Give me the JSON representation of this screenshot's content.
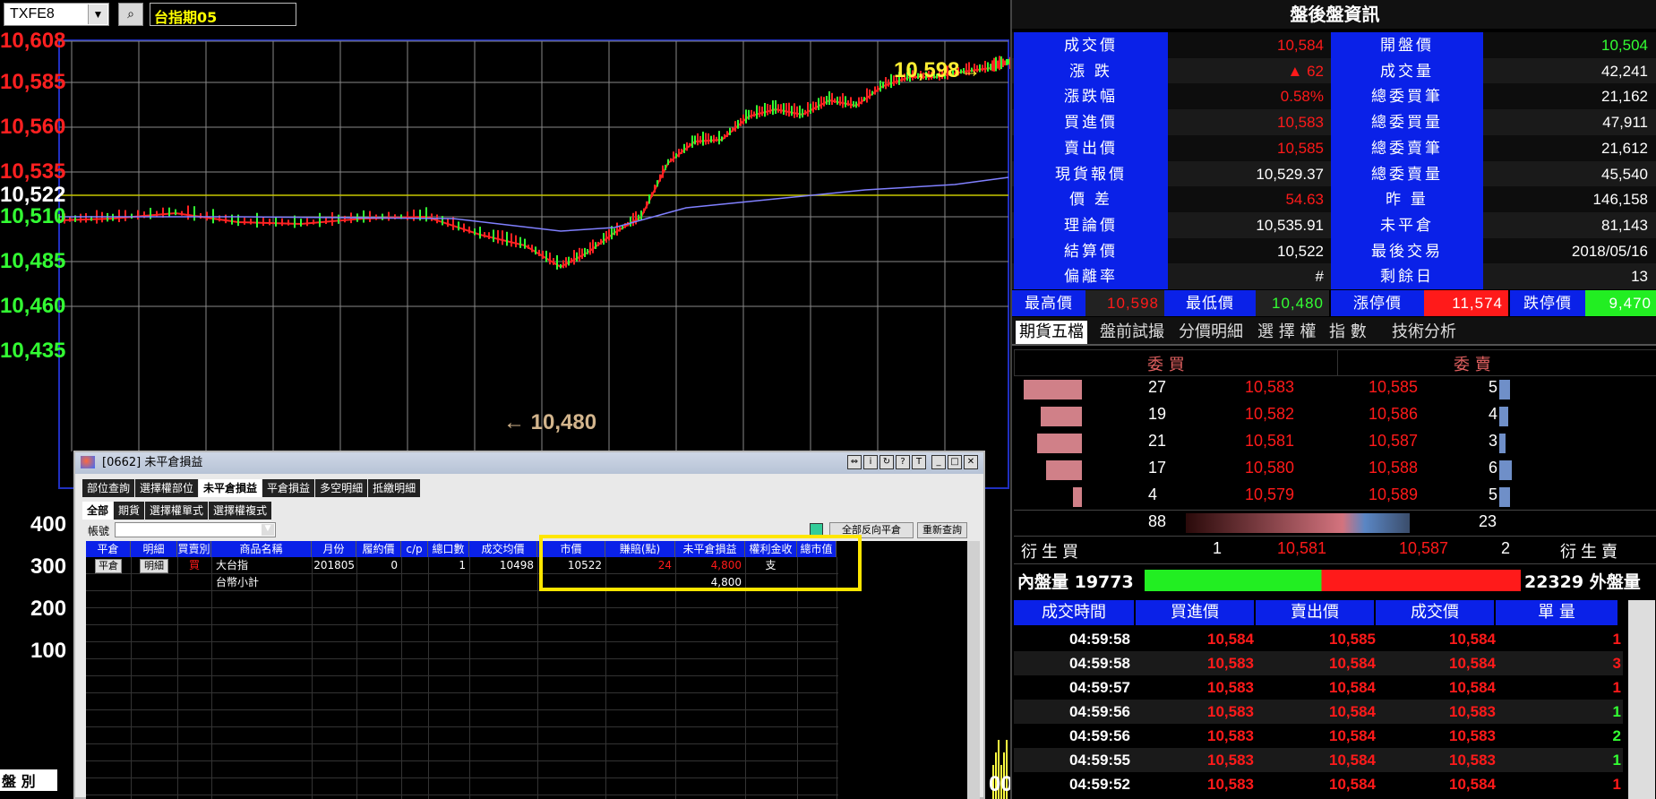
{
  "toolbar": {
    "symbol": "TXFE8",
    "product": "台指期05",
    "dropdown_arrow": "▼",
    "query_icon": "search-icon"
  },
  "chart": {
    "y_labels": [
      {
        "text": "10,608",
        "color": "#ff2020"
      },
      {
        "text": "10,585",
        "color": "#ff2020"
      },
      {
        "text": "10,560",
        "color": "#ff2020"
      },
      {
        "text": "10,535",
        "color": "#ff2020"
      },
      {
        "text": "10,522",
        "color": "#ffffff"
      },
      {
        "text": "10,510",
        "color": "#33ff33"
      },
      {
        "text": "10,485",
        "color": "#33ff33"
      },
      {
        "text": "10,460",
        "color": "#33ff33"
      },
      {
        "text": "10,435",
        "color": "#33ff33"
      }
    ],
    "high_marker": "10,598→",
    "low_marker": "← 10,480",
    "vol_labels": [
      "400",
      "300",
      "200",
      "100"
    ],
    "vol_right_label": "00",
    "bottom_left_label": "盤 別"
  },
  "chart_data": {
    "type": "line",
    "title": "",
    "ylim": [
      10435,
      10608
    ],
    "reference_price": 10522,
    "high": 10598,
    "low": 10480,
    "last": 10584
  },
  "right_panel": {
    "title": "盤後盤資訊",
    "quotes": [
      {
        "l1": "成交價",
        "v1": "10,584",
        "c1": "red",
        "l2": "開盤價",
        "v2": "10,504",
        "c2": "grn"
      },
      {
        "l1": "漲 跌",
        "v1": "▲ 62",
        "c1": "red",
        "l2": "成交量",
        "v2": "42,241",
        "c2": "wht"
      },
      {
        "l1": "漲跌幅",
        "v1": "0.58%",
        "c1": "red",
        "l2": "總委買筆",
        "v2": "21,162",
        "c2": "wht"
      },
      {
        "l1": "買進價",
        "v1": "10,583",
        "c1": "red",
        "l2": "總委買量",
        "v2": "47,911",
        "c2": "wht"
      },
      {
        "l1": "賣出價",
        "v1": "10,585",
        "c1": "red",
        "l2": "總委賣筆",
        "v2": "21,612",
        "c2": "wht"
      },
      {
        "l1": "現貨報價",
        "v1": "10,529.37",
        "c1": "wht",
        "l2": "總委賣量",
        "v2": "45,540",
        "c2": "wht"
      },
      {
        "l1": "價 差",
        "v1": "54.63",
        "c1": "red",
        "l2": "昨 量",
        "v2": "146,158",
        "c2": "wht"
      },
      {
        "l1": "理論價",
        "v1": "10,535.91",
        "c1": "wht",
        "l2": "未平倉",
        "v2": "81,143",
        "c2": "wht"
      },
      {
        "l1": "結算價",
        "v1": "10,522",
        "c1": "wht",
        "l2": "最後交易",
        "v2": "2018/05/16",
        "c2": "wht"
      },
      {
        "l1": "偏離率",
        "v1": "#",
        "c1": "wht",
        "l2": "剩餘日",
        "v2": "13",
        "c2": "wht"
      }
    ],
    "hl_row": {
      "high_label": "最高價",
      "high": "10,598",
      "low_label": "最低價",
      "low": "10,480",
      "up_label": "漲停價",
      "up": "11,574",
      "down_label": "跌停價",
      "down": "9,470"
    },
    "tabs": [
      "期貨五檔",
      "盤前試撮",
      "分價明細",
      "選 擇 權",
      "指 數",
      "技術分析"
    ],
    "book_headers": {
      "bid": "委 買",
      "ask": "委 賣"
    },
    "book": [
      {
        "bq": "27",
        "bp": "10,583",
        "ap": "10,585",
        "aq": "5",
        "bw": 0.85,
        "aw": 0.2
      },
      {
        "bq": "19",
        "bp": "10,582",
        "ap": "10,586",
        "aq": "4",
        "bw": 0.6,
        "aw": 0.16
      },
      {
        "bq": "21",
        "bp": "10,581",
        "ap": "10,587",
        "aq": "3",
        "bw": 0.66,
        "aw": 0.12
      },
      {
        "bq": "17",
        "bp": "10,580",
        "ap": "10,588",
        "aq": "6",
        "bw": 0.53,
        "aw": 0.24
      },
      {
        "bq": "4",
        "bp": "10,579",
        "ap": "10,589",
        "aq": "5",
        "bw": 0.13,
        "aw": 0.2
      }
    ],
    "book_totals": {
      "bid": "88",
      "ask": "23"
    },
    "derived": {
      "bid_label": "衍 生 買",
      "bid_q": "1",
      "bid_p": "10,581",
      "ask_p": "10,587",
      "ask_q": "2",
      "ask_label": "衍 生 賣"
    },
    "inout": {
      "in_label": "內盤量 19773",
      "out_label": "22329 外盤量",
      "in_ratio": 0.47
    },
    "trade_headers": [
      "成交時間",
      "買進價",
      "賣出價",
      "成交價",
      "單 量"
    ],
    "trades": [
      {
        "t": "04:59:58",
        "b": "10,584",
        "s": "10,585",
        "p": "10,584",
        "q": "1",
        "qc": "red"
      },
      {
        "t": "04:59:58",
        "b": "10,583",
        "s": "10,584",
        "p": "10,584",
        "q": "3",
        "qc": "red"
      },
      {
        "t": "04:59:57",
        "b": "10,583",
        "s": "10,584",
        "p": "10,584",
        "q": "1",
        "qc": "red"
      },
      {
        "t": "04:59:56",
        "b": "10,583",
        "s": "10,584",
        "p": "10,583",
        "q": "1",
        "qc": "grn"
      },
      {
        "t": "04:59:56",
        "b": "10,583",
        "s": "10,584",
        "p": "10,583",
        "q": "2",
        "qc": "grn"
      },
      {
        "t": "04:59:55",
        "b": "10,583",
        "s": "10,584",
        "p": "10,583",
        "q": "1",
        "qc": "grn"
      },
      {
        "t": "04:59:52",
        "b": "10,583",
        "s": "10,584",
        "p": "10,584",
        "q": "1",
        "qc": "red"
      }
    ]
  },
  "popup": {
    "title": "[0662] 未平倉損益",
    "tabs1": [
      "部位查詢",
      "選擇權部位",
      "未平倉損益",
      "平倉損益",
      "多空明細",
      "抵繳明細"
    ],
    "tabs2": [
      "全部",
      "期貨",
      "選擇權單式",
      "選擇權複式"
    ],
    "account_label": "帳號",
    "btn_close_all": "全部反向平倉",
    "btn_requery": "重新查詢",
    "headers": [
      "平倉",
      "明細",
      "買賣別",
      "商品名稱",
      "月份",
      "履約價",
      "c/p",
      "總口數",
      "成交均價",
      "市價",
      "賺賠(點)",
      "未平倉損益",
      "權利金收支",
      "總市值"
    ],
    "row": {
      "close_btn": "平倉",
      "detail_btn": "明細",
      "side": "買",
      "name": "大台指",
      "month": "201805",
      "strike": "0",
      "cp": "",
      "lots": "1",
      "avg": "10498",
      "mkt": "10522",
      "pts": "24",
      "pnl": "4,800"
    },
    "subtotal": {
      "label": "台幣小計",
      "pnl": "4,800"
    }
  }
}
